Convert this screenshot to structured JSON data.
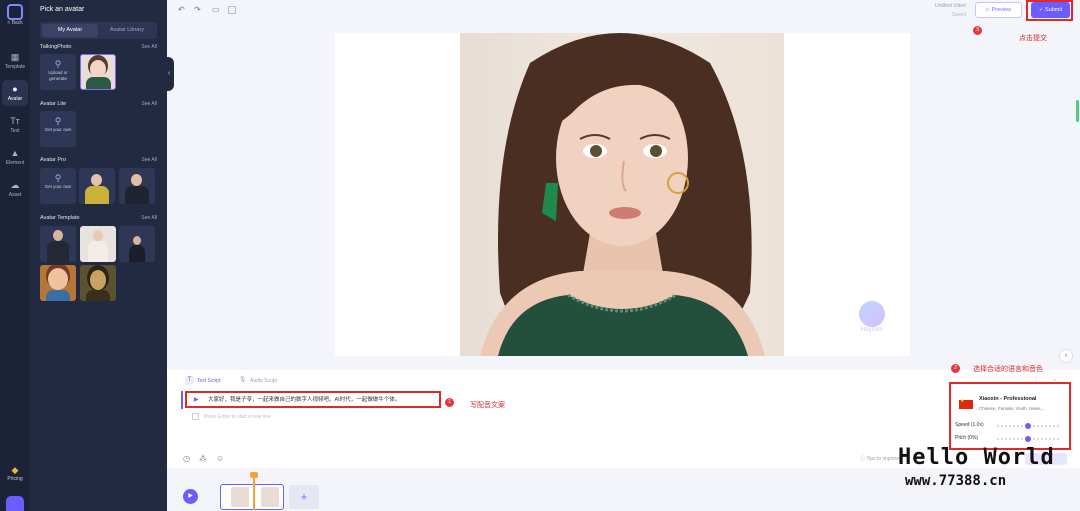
{
  "rail": {
    "back": "< Back",
    "items": [
      {
        "label": "Template",
        "icon": "template-icon"
      },
      {
        "label": "Avatar",
        "icon": "avatar-icon"
      },
      {
        "label": "Text",
        "icon": "text-icon"
      },
      {
        "label": "Element",
        "icon": "element-icon"
      },
      {
        "label": "Asset",
        "icon": "asset-icon"
      }
    ],
    "pricing": "Pricing"
  },
  "panel": {
    "title": "Pick an avatar",
    "tabs": [
      "My Avatar",
      "Avatar Library"
    ],
    "see_all": "See All",
    "sections": {
      "talking_photo": {
        "title": "TalkingPhoto",
        "add_label": "Upload or generate"
      },
      "avatar_lite": {
        "title": "Avatar Lite",
        "add_label": "Get your own"
      },
      "avatar_pro": {
        "title": "Avatar Pro",
        "add_label": "Get your own"
      },
      "avatar_template": {
        "title": "Avatar Template"
      }
    }
  },
  "toolbar": {
    "doc_title": "Untitled Video",
    "doc_status": "Saved",
    "preview_label": "Preview",
    "submit_label": "Submit"
  },
  "annotations": {
    "step1_num": "1",
    "step1_label": "写配音文案",
    "step2_num": "2",
    "step2_label": "选择合适的语言和音色",
    "step3_num": "3",
    "step3_label": "点击提交"
  },
  "canvas": {
    "watermark_text": "HeyGen"
  },
  "script": {
    "tab_text": "Text Script",
    "tab_audio": "Audio Script",
    "line1": "大家好，我是子苓，一起来做自己的数字人视频吧。AI时代，一起做做牛个体。",
    "line2": "Press Enter to start a new line",
    "tips": "Tips to improve"
  },
  "voice": {
    "name": "Xiaoxin - Professional",
    "desc": "Chinese, Female, Youth, News,...",
    "speed_label": "Speed (1.0x)",
    "pitch_label": "Pitch (0%)",
    "speed_value": 1.0,
    "pitch_value": 0
  },
  "overlay": {
    "title": "Hello World",
    "url": "www.77388.cn"
  },
  "colors": {
    "accent": "#6c5cff",
    "annotation_red": "#e02a2a",
    "sidebar_bg": "#222a42"
  }
}
